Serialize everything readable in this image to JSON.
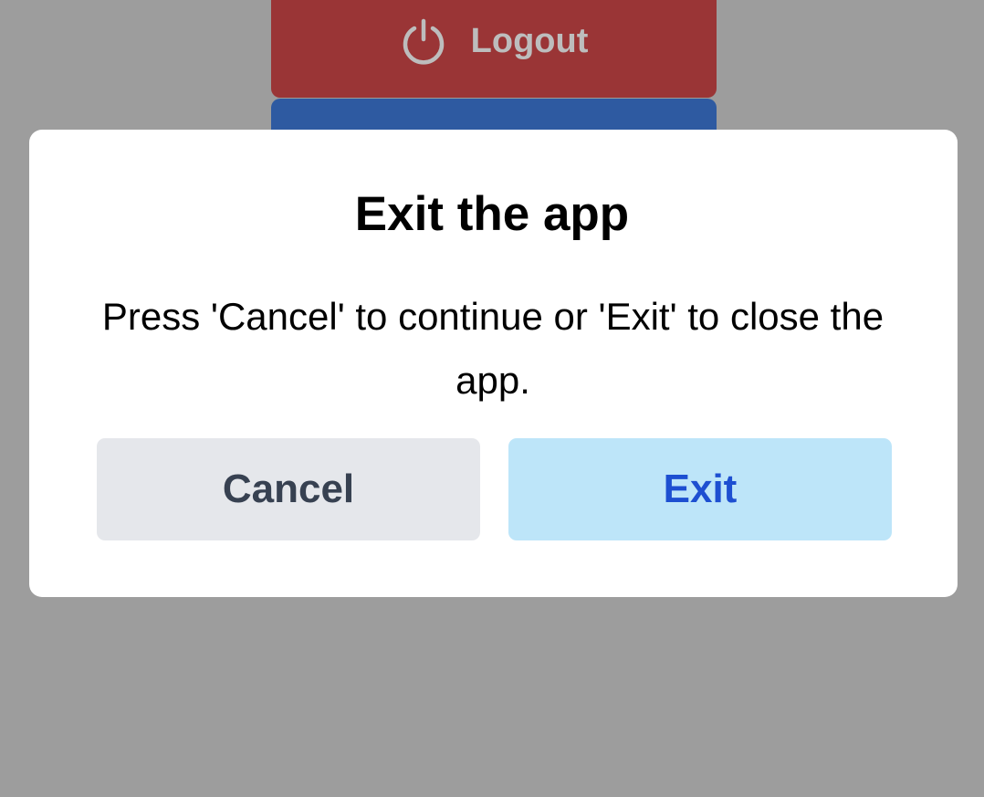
{
  "background": {
    "logout_button": {
      "label": "Logout",
      "icon": "power-icon",
      "color": "#9a3536"
    },
    "secondary_button": {
      "color": "#2e5aa1"
    }
  },
  "dialog": {
    "title": "Exit the app",
    "message": "Press 'Cancel' to continue or 'Exit' to close the app.",
    "cancel_label": "Cancel",
    "exit_label": "Exit",
    "exit_color": "#1d4fd1",
    "exit_bg": "#bde5f9"
  }
}
